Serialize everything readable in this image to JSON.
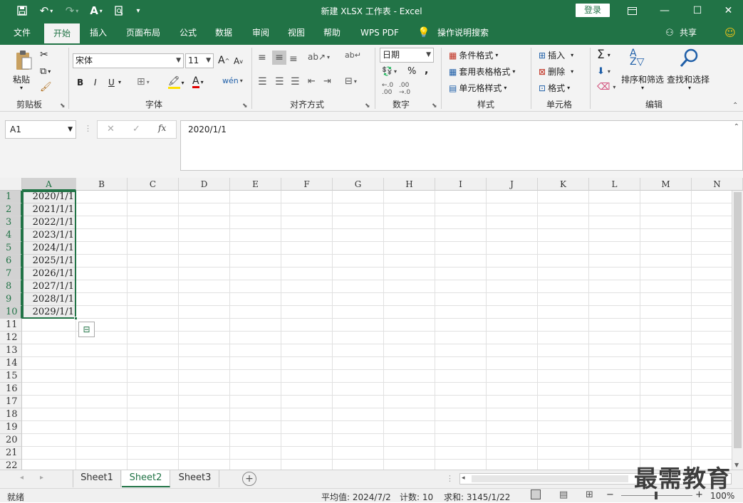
{
  "window": {
    "title": "新建 XLSX 工作表  -  Excel",
    "login": "登录"
  },
  "tabs": [
    "文件",
    "开始",
    "插入",
    "页面布局",
    "公式",
    "数据",
    "审阅",
    "视图",
    "帮助",
    "WPS PDF",
    "操作说明搜索"
  ],
  "share": "共享",
  "ribbon": {
    "clipboard": {
      "paste": "粘贴",
      "label": "剪贴板"
    },
    "font": {
      "name": "宋体",
      "size": "11",
      "label": "字体",
      "bold": "B",
      "italic": "I",
      "underline": "U"
    },
    "alignment": {
      "label": "对齐方式"
    },
    "number": {
      "format": "日期",
      "label": "数字",
      "percent": "%",
      "comma": ","
    },
    "styles": {
      "conditional": "条件格式",
      "table": "套用表格格式",
      "cell": "单元格样式",
      "label": "样式"
    },
    "cells": {
      "insert": "插入",
      "delete": "删除",
      "format": "格式",
      "label": "单元格"
    },
    "editing": {
      "sort": "排序和筛选",
      "find": "查找和选择",
      "label": "编辑"
    }
  },
  "formula_bar": {
    "name_box": "A1",
    "fx": "fx",
    "value": "2020/1/1"
  },
  "columns": [
    "A",
    "B",
    "C",
    "D",
    "E",
    "F",
    "G",
    "H",
    "I",
    "J",
    "K",
    "L",
    "M",
    "N"
  ],
  "rows": [
    "1",
    "2",
    "3",
    "4",
    "5",
    "6",
    "7",
    "8",
    "9",
    "10",
    "11",
    "12",
    "13",
    "14",
    "15",
    "16",
    "17",
    "18",
    "19",
    "20",
    "21",
    "22"
  ],
  "cells_a": [
    "2020/1/1",
    "2021/1/1",
    "2022/1/1",
    "2023/1/1",
    "2024/1/1",
    "2025/1/1",
    "2026/1/1",
    "2027/1/1",
    "2028/1/1",
    "2029/1/1"
  ],
  "sheets": [
    "Sheet1",
    "Sheet2",
    "Sheet3"
  ],
  "status": {
    "mode": "就绪",
    "average": "平均值: 2024/7/2",
    "count": "计数: 10",
    "sum": "求和: 3145/1/22",
    "zoom": "100%"
  },
  "watermark": "最需教育",
  "colors": {
    "accent": "#217346"
  }
}
